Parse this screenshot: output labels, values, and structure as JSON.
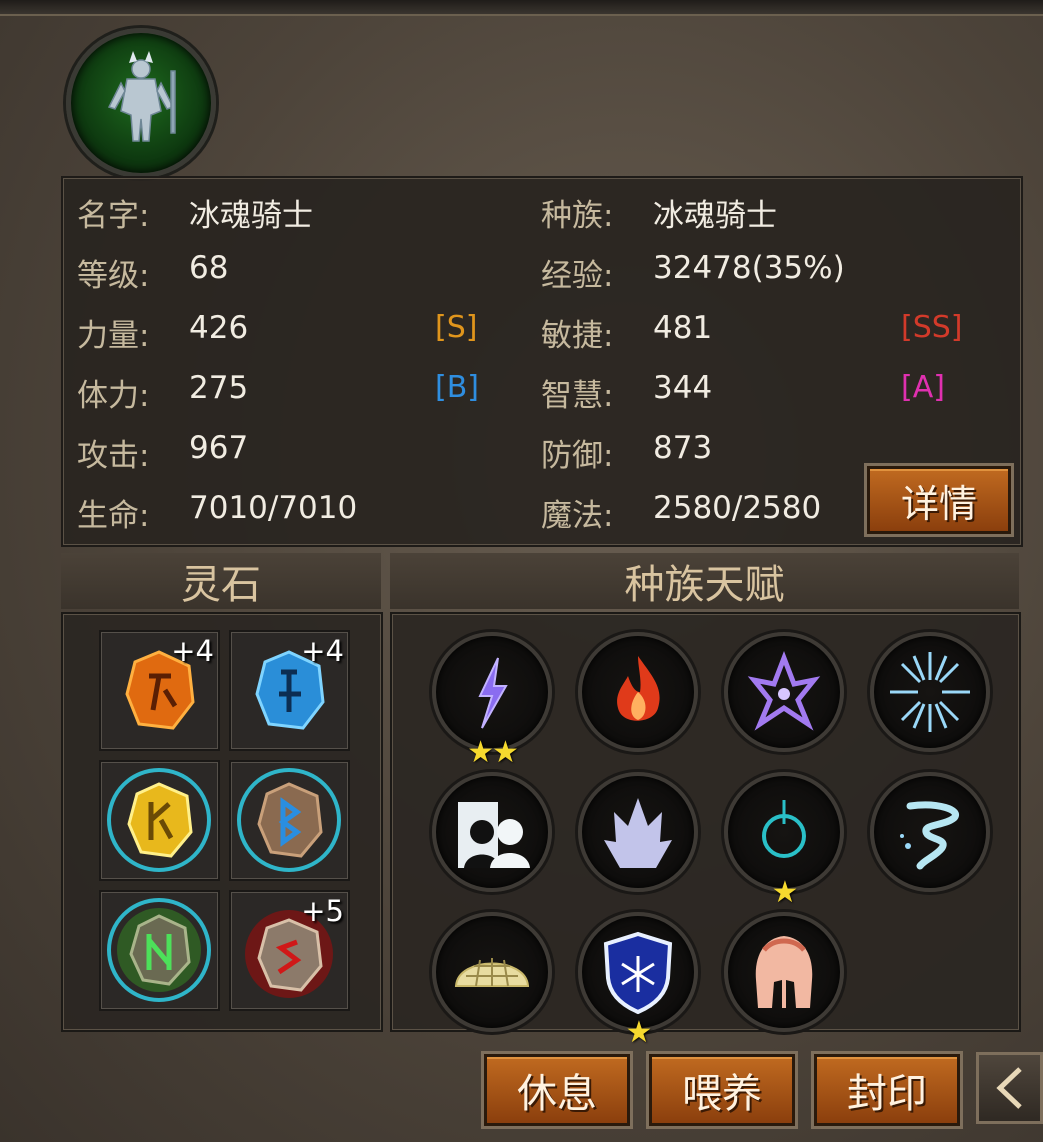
{
  "character": {
    "name_label": "名字:",
    "name": "冰魂骑士",
    "race_label": "种族:",
    "race": "冰魂骑士",
    "level_label": "等级:",
    "level": "68",
    "exp_label": "经验:",
    "exp": "32478(35%)",
    "str_label": "力量:",
    "str": "426",
    "str_grade": "[S]",
    "agi_label": "敏捷:",
    "agi": "481",
    "agi_grade": "[SS]",
    "sta_label": "体力:",
    "sta": "275",
    "sta_grade": "[B]",
    "int_label": "智慧:",
    "int": "344",
    "int_grade": "[A]",
    "atk_label": "攻击:",
    "atk": "967",
    "def_label": "防御:",
    "def": "873",
    "hp_label": "生命:",
    "hp": "7010/7010",
    "mp_label": "魔法:",
    "mp": "2580/2580"
  },
  "grade_colors": {
    "S": "#e0951c",
    "SS": "#d23a2a",
    "B": "#2f8ee0",
    "A": "#e030b0"
  },
  "buttons": {
    "details": "详情",
    "rest": "休息",
    "feed": "喂养",
    "seal": "封印",
    "back_icon": "chevron-left-icon"
  },
  "spirit_stones": {
    "title": "灵石",
    "slots": [
      {
        "icon": "orange-rune-stone-icon",
        "plus": "+4"
      },
      {
        "icon": "blue-rune-stone-icon",
        "plus": "+4"
      },
      {
        "icon": "gold-rune-stone-icon",
        "plus": ""
      },
      {
        "icon": "bronze-rune-stone-icon",
        "plus": ""
      },
      {
        "icon": "green-rune-stone-icon",
        "plus": ""
      },
      {
        "icon": "red-rune-stone-icon",
        "plus": "+5"
      }
    ]
  },
  "race_talents": {
    "title": "种族天赋",
    "items": [
      {
        "icon": "lightning-icon",
        "stars": 2
      },
      {
        "icon": "fire-icon",
        "stars": 0
      },
      {
        "icon": "purple-emblem-icon",
        "stars": 0
      },
      {
        "icon": "frost-burst-icon",
        "stars": 0
      },
      {
        "icon": "silhouettes-icon",
        "stars": 0
      },
      {
        "icon": "ice-crystal-icon",
        "stars": 0
      },
      {
        "icon": "power-ring-icon",
        "stars": 1
      },
      {
        "icon": "whirlwind-icon",
        "stars": 0
      },
      {
        "icon": "turtle-shell-icon",
        "stars": 0
      },
      {
        "icon": "snowflake-shield-icon",
        "stars": 1
      },
      {
        "icon": "spartan-helmet-icon",
        "stars": 0
      }
    ]
  }
}
